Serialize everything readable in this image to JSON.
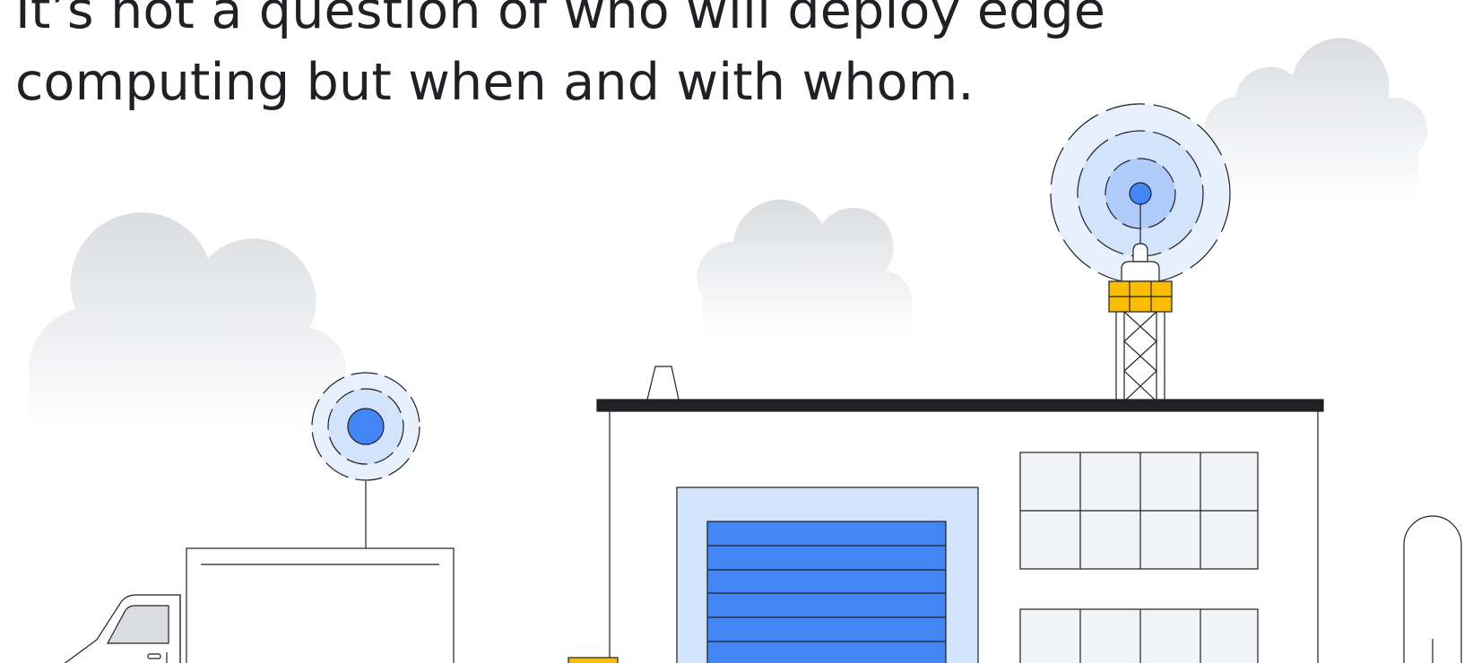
{
  "headline": {
    "line1": "It’s not a question of who will deploy edge",
    "line2": "computing but when and with whom."
  },
  "colors": {
    "text": "#202124",
    "ink": "#202124",
    "blue": "#4285f4",
    "light_blue": "#d2e3fc",
    "pale_blue": "#e8f0fe",
    "mid_blue": "#aecbfa",
    "yellow": "#fbbc04",
    "window_gray": "#f1f3f4",
    "cloud_gray": "#dadce0"
  },
  "icons": [
    "cloud-icon",
    "signal-wave-icon",
    "antenna-tower-icon",
    "warehouse-building-icon",
    "delivery-truck-icon"
  ]
}
